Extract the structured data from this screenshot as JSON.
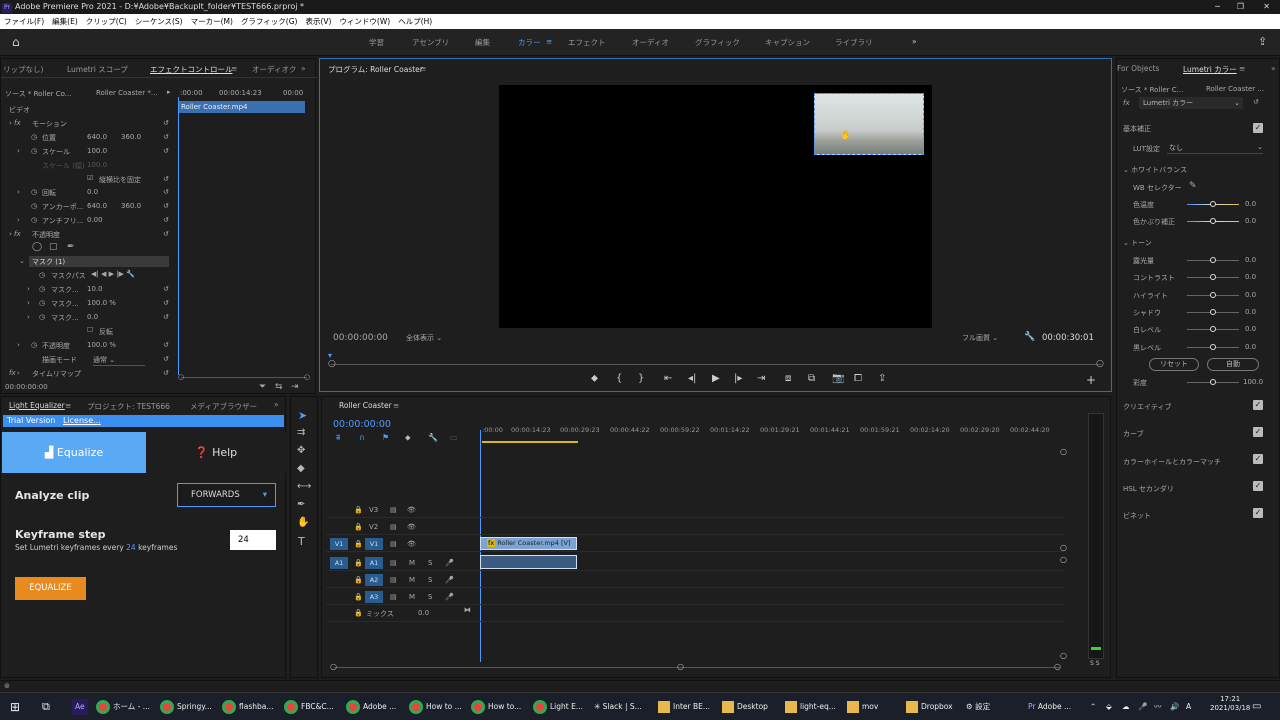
{
  "window": {
    "title": "Adobe Premiere Pro 2021 - D:¥Adobe¥BackupIt_folder¥TEST666.prproj *"
  },
  "menu": [
    "ファイル(F)",
    "編集(E)",
    "クリップ(C)",
    "シーケンス(S)",
    "マーカー(M)",
    "グラフィック(G)",
    "表示(V)",
    "ウィンドウ(W)",
    "ヘルプ(H)"
  ],
  "workspaces": [
    "学習",
    "アセンブリ",
    "編集",
    "カラー",
    "エフェクト",
    "オーディオ",
    "グラフィック",
    "キャプション",
    "ライブラリ"
  ],
  "effect_controls": {
    "tabs": [
      "リップなし)",
      "Lumetri スコープ",
      "エフェクトコントロール",
      "オーディオク"
    ],
    "source": "ソース * Roller Co...",
    "seq": "Roller Coaster *...",
    "tc1": ":00:00",
    "tc2": "00:00:14:23",
    "tc3": "00:00",
    "clip": "Roller Coaster.mp4",
    "video_label": "ビデオ",
    "motion": "モーション",
    "position": "位置",
    "pos_x": "640.0",
    "pos_y": "360.0",
    "scale": "スケール",
    "scale_v": "100.0",
    "scale_w": "スケール (幅)",
    "scale_w_v": "100.0",
    "uniform": "縦横比を固定",
    "rotation": "回転",
    "rot_v": "0.0",
    "anchor": "アンカーポ...",
    "anc_x": "640.0",
    "anc_y": "360.0",
    "anti": "アンチフリ...",
    "anti_v": "0.00",
    "opacity": "不透明度",
    "mask": "マスク (1)",
    "mask_path": "マスクパス",
    "mask_f": "マスク...",
    "mask_f_v": "10.0",
    "mask_o": "マスク...",
    "mask_o_v": "100.0 %",
    "mask_e": "マスク...",
    "mask_e_v": "0.0",
    "invert": "反転",
    "opacity2": "不透明度",
    "opacity2_v": "100.0 %",
    "blend": "描画モード",
    "blend_v": "通常",
    "remap": "タイムリマップ",
    "tc_bottom": "00:00:00:00"
  },
  "program": {
    "title": "プログラム: Roller Coaster",
    "tc": "00:00:00:00",
    "fit": "全体表示",
    "quality": "フル画質",
    "duration": "00:00:30:01"
  },
  "light_eq": {
    "tabs": [
      "Light Equalizer",
      "プロジェクト: TEST666",
      "メディアブラウザー"
    ],
    "trial": "Trial Version",
    "license": "License...",
    "equalize_tab": "Equalize",
    "help_tab": "Help",
    "analyze": "Analyze clip",
    "direction": "FORWARDS",
    "keyframe_title": "Keyframe step",
    "kf_desc1": "Set Lumetri keyframes every",
    "kf_num": "24",
    "kf_desc2": "keyframes",
    "kf_value": "24",
    "button": "EQUALIZE"
  },
  "timeline": {
    "title": "Roller Coaster",
    "tc": "00:00:00:00",
    "ruler": [
      ":00:00",
      "00:00:14:23",
      "00:00:29:23",
      "00:00:44:22",
      "00:00:59:22",
      "00:01:14:22",
      "00:01:29:21",
      "00:01:44:21",
      "00:01:59:21",
      "00:02:14:20",
      "00:02:29:20",
      "00:02:44:20"
    ],
    "tracks": [
      "V3",
      "V2",
      "V1",
      "A1",
      "A2",
      "A3"
    ],
    "mix": "ミックス",
    "mix_v": "0.0",
    "clip": "Roller Coaster.mp4 [V]",
    "meter": "S S"
  },
  "lumetri": {
    "tabs": [
      "For Objects",
      "Lumetri カラー"
    ],
    "source": "ソース * Roller C...",
    "seq": "Roller Coaster ...",
    "fx": "Lumetri カラー",
    "basic": "基本補正",
    "lut": "LUT設定",
    "lut_v": "なし",
    "wb": "ホワイトバランス",
    "wb_sel": "WB セレクター",
    "temp": "色温度",
    "temp_v": "0.0",
    "tint": "色かぶり補正",
    "tint_v": "0.0",
    "tone": "トーン",
    "exposure": "露光量",
    "exposure_v": "0.0",
    "contrast": "コントラスト",
    "contrast_v": "0.0",
    "highlights": "ハイライト",
    "highlights_v": "0.0",
    "shadows": "シャドウ",
    "shadows_v": "0.0",
    "whites": "白レベル",
    "whites_v": "0.0",
    "blacks": "黒レベル",
    "blacks_v": "0.0",
    "reset": "リセット",
    "auto": "自動",
    "sat": "彩度",
    "sat_v": "100.0",
    "creative": "クリエイティブ",
    "curves": "カーブ",
    "wheels": "カラーホイールとカラーマッチ",
    "hsl": "HSL セカンダリ",
    "vignette": "ビネット"
  },
  "taskbar": {
    "items": [
      "ホーム - ...",
      "Springy...",
      "flashba...",
      "FBC&C...",
      "Adobe ...",
      "How to ...",
      "How to...",
      "Light E...",
      "Slack | S...",
      "Inter BE...",
      "Desktop",
      "light-eq...",
      "mov",
      "Dropbox",
      "設定",
      "Adobe ..."
    ],
    "time": "17:21",
    "date": "2021/03/18",
    "lang": "A"
  }
}
